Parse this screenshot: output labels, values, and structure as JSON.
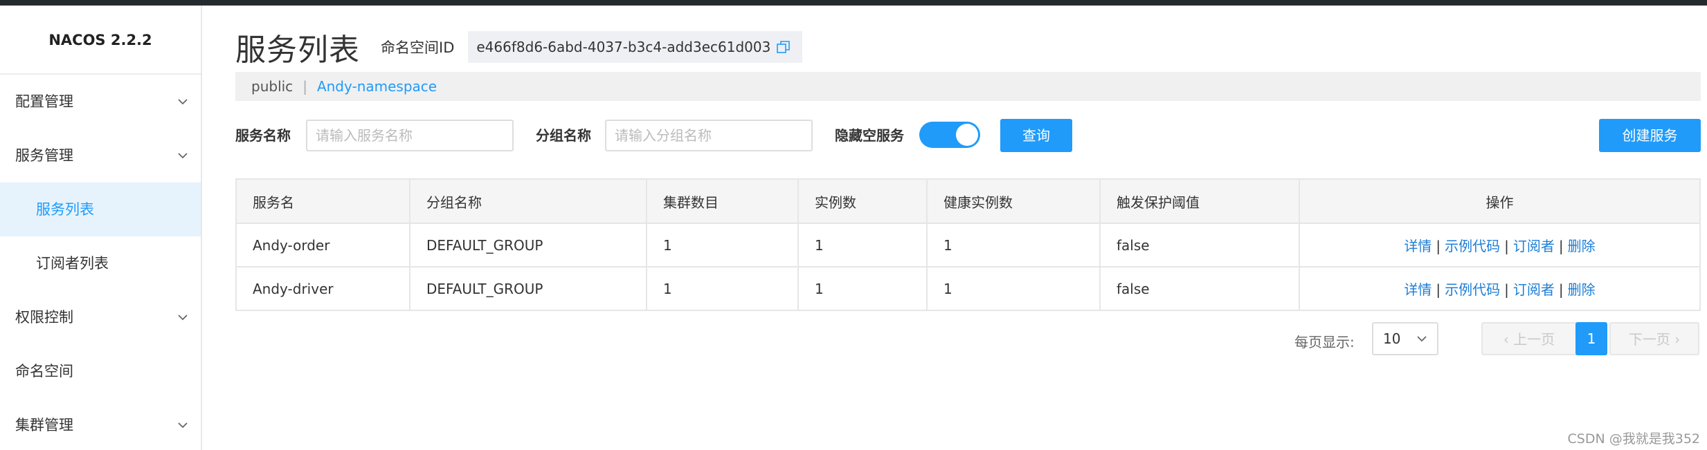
{
  "app": {
    "logo": "NACOS 2.2.2"
  },
  "sidebar": {
    "items": [
      {
        "label": "配置管理",
        "expandable": true
      },
      {
        "label": "服务管理",
        "expandable": true
      },
      {
        "label": "服务列表",
        "sub": true,
        "active": true
      },
      {
        "label": "订阅者列表",
        "sub": true
      },
      {
        "label": "权限控制",
        "expandable": true
      },
      {
        "label": "命名空间"
      },
      {
        "label": "集群管理",
        "expandable": true
      }
    ]
  },
  "header": {
    "title": "服务列表",
    "namespace_label": "命名空间ID",
    "namespace_id": "e466f8d6-6abd-4037-b3c4-add3ec61d003",
    "copy_icon": "copy-icon"
  },
  "namespaces": {
    "items": [
      "public",
      "Andy-namespace"
    ],
    "separator": "|"
  },
  "filters": {
    "service_label": "服务名称",
    "service_placeholder": "请输入服务名称",
    "group_label": "分组名称",
    "group_placeholder": "请输入分组名称",
    "hide_empty_label": "隐藏空服务",
    "hide_empty_on": true,
    "query_button": "查询",
    "create_button": "创建服务"
  },
  "table": {
    "headers": [
      "服务名",
      "分组名称",
      "集群数目",
      "实例数",
      "健康实例数",
      "触发保护阈值",
      "操作"
    ],
    "rows": [
      {
        "name": "Andy-order",
        "group": "DEFAULT_GROUP",
        "clusters": "1",
        "instances": "1",
        "healthy": "1",
        "threshold": "false"
      },
      {
        "name": "Andy-driver",
        "group": "DEFAULT_GROUP",
        "clusters": "1",
        "instances": "1",
        "healthy": "1",
        "threshold": "false"
      }
    ],
    "ops": {
      "detail": "详情",
      "sample": "示例代码",
      "subscribers": "订阅者",
      "delete": "删除",
      "sep": "|"
    }
  },
  "pagination": {
    "page_size_label": "每页显示:",
    "page_size": "10",
    "prev": "上一页",
    "current": "1",
    "next": "下一页"
  },
  "watermark": "CSDN @我就是我352",
  "colors": {
    "accent": "#209bfa",
    "link": "#1c7ed6",
    "active_bg": "#e6f3fd"
  }
}
